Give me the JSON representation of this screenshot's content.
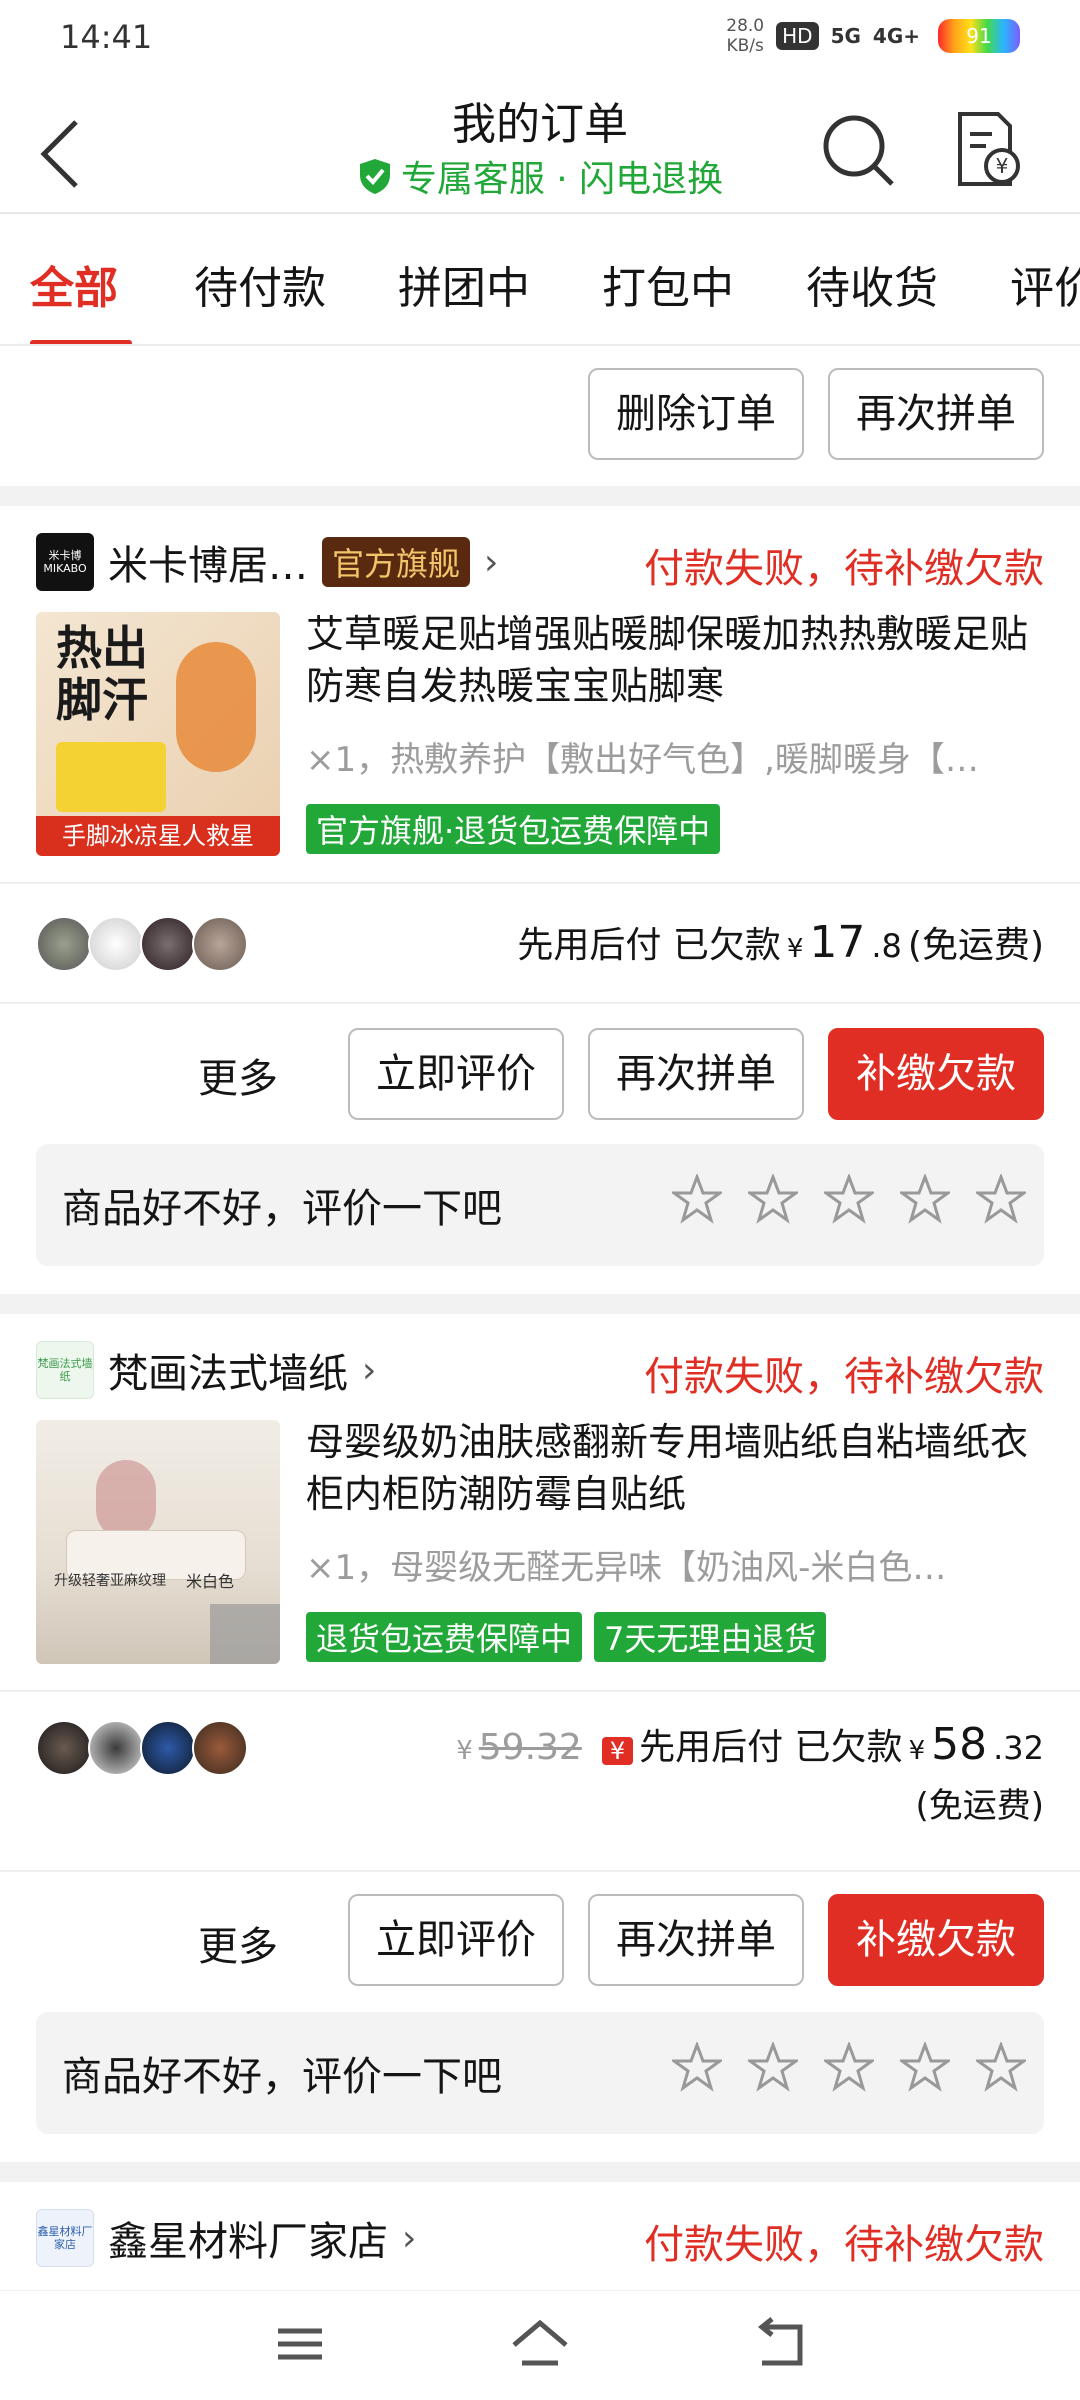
{
  "status_bar": {
    "time": "14:41",
    "net_speed_value": "28.0",
    "net_speed_unit": "KB/s",
    "signal_a": "HD",
    "signal_b": "5G",
    "signal_c": "4G+",
    "battery": "91"
  },
  "header": {
    "title": "我的订单",
    "subtitle": "专属客服 · 闪电退换"
  },
  "tabs": [
    "全部",
    "待付款",
    "拼团中",
    "打包中",
    "待收货",
    "评价"
  ],
  "top_actions": {
    "delete": "删除订单",
    "regroup": "再次拼单"
  },
  "orders": [
    {
      "shop_logo_text": "米卡博 MIKABO",
      "shop_name": "米卡博居…",
      "shop_flag": "官方旗舰",
      "status": "付款失败，待补缴欠款",
      "product_name": "艾草暖足贴增强贴暖脚保暖加热热敷暖足贴防寒自发热暖宝宝贴脚寒",
      "product_spec": "×1，热敷养护【敷出好气色】,暖脚暖身【…",
      "thumb_text_1": "热出",
      "thumb_text_2": "脚汗",
      "thumb_banner": "手脚冰凉星人救星",
      "tags": [
        "官方旗舰·退货包运费保障中"
      ],
      "pay_label": "先用后付 已欠款",
      "price_int": "17",
      "price_dec": ".8",
      "shipping": "(免运费)",
      "more": "更多",
      "btn_review": "立即评价",
      "btn_regroup": "再次拼单",
      "btn_pay": "补缴欠款",
      "review_prompt": "商品好不好，评价一下吧"
    },
    {
      "shop_logo_text": "梵画法式墙纸",
      "shop_name": "梵画法式墙纸",
      "status": "付款失败，待补缴欠款",
      "product_name": "母婴级奶油肤感翻新专用墙贴纸自粘墙纸衣柜内柜防潮防霉自贴纸",
      "product_spec": "×1，母婴级无醛无异味【奶油风-米白色…",
      "thumb_text_1": "升级轻奢亚麻纹理",
      "thumb_text_2": "米白色",
      "tags": [
        "退货包运费保障中",
        "7天无理由退货"
      ],
      "orig_price": "59.32",
      "pay_badge": "¥",
      "pay_label": "先用后付 已欠款",
      "price_int": "58",
      "price_dec": ".32",
      "shipping": "(免运费)",
      "more": "更多",
      "btn_review": "立即评价",
      "btn_regroup": "再次拼单",
      "btn_pay": "补缴欠款",
      "review_prompt": "商品好不好，评价一下吧"
    },
    {
      "shop_logo_text": "鑫星材料厂家店",
      "shop_name": "鑫星材料厂家店",
      "status": "付款失败，待补缴欠款"
    }
  ],
  "yen_symbol": "¥",
  "colors": {
    "accent": "#e02e24",
    "green": "#22a839",
    "gray_text": "#9c9c9c"
  }
}
